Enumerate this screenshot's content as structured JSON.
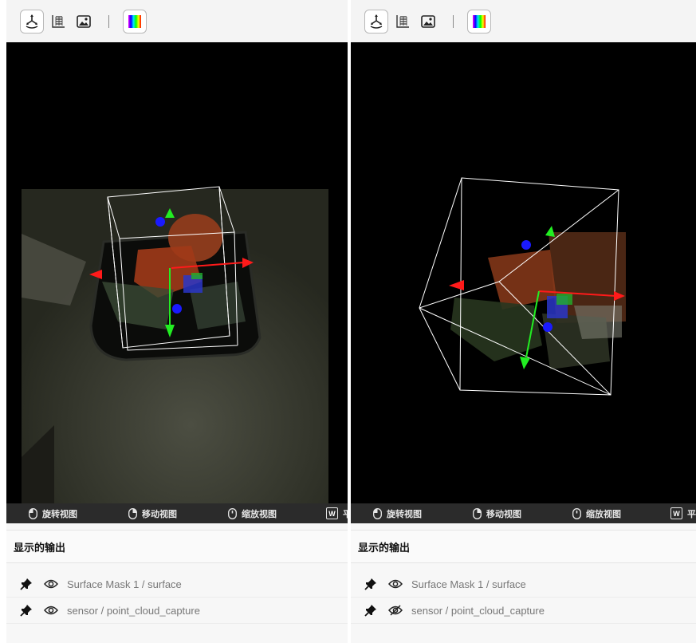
{
  "panels": [
    {
      "toolbar": {
        "buttons": [
          {
            "icon": "3d-view-icon",
            "active": true
          },
          {
            "icon": "table-icon",
            "active": false
          },
          {
            "icon": "image-icon",
            "active": false
          },
          {
            "icon": "color-spectrum-icon",
            "active": false
          }
        ]
      },
      "hints": {
        "rotate": "旋转视图",
        "move": "移动视图",
        "zoom": "缩放视图",
        "pan_key": "W",
        "pan": "平"
      },
      "outputs": {
        "header": "显示的输出",
        "items": [
          {
            "label": "Surface Mask 1 / surface",
            "visible": true,
            "pinned": true
          },
          {
            "label": "sensor / point_cloud_capture",
            "visible": true,
            "pinned": true
          }
        ]
      }
    },
    {
      "toolbar": {
        "buttons": [
          {
            "icon": "3d-view-icon",
            "active": true
          },
          {
            "icon": "table-icon",
            "active": false
          },
          {
            "icon": "image-icon",
            "active": false
          },
          {
            "icon": "color-spectrum-icon",
            "active": false
          }
        ]
      },
      "hints": {
        "rotate": "旋转视图",
        "move": "移动视图",
        "zoom": "缩放视图",
        "pan_key": "W",
        "pan": "平"
      },
      "outputs": {
        "header": "显示的输出",
        "items": [
          {
            "label": "Surface Mask 1 / surface",
            "visible": true,
            "pinned": true
          },
          {
            "label": "sensor / point_cloud_capture",
            "visible": false,
            "pinned": true
          }
        ]
      }
    }
  ],
  "colors": {
    "axis_x": "#ff1a1a",
    "axis_y": "#22ee22",
    "axis_z": "#1a1aff",
    "bbox": "#ffffff",
    "viewport_bg": "#000000",
    "hintbar_bg": "#2b2b2b"
  }
}
